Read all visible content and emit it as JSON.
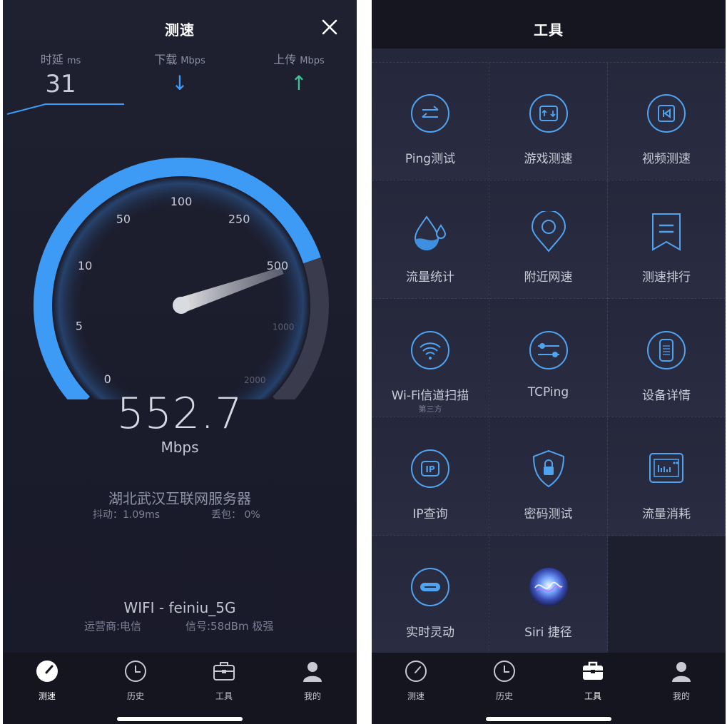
{
  "left": {
    "title": "测速",
    "latency": {
      "label": "时延",
      "unit": "ms",
      "value": "31"
    },
    "download": {
      "label": "下载",
      "unit": "Mbps"
    },
    "upload": {
      "label": "上传",
      "unit": "Mbps"
    },
    "gauge_ticks": [
      "0",
      "5",
      "10",
      "50",
      "100",
      "250",
      "500",
      "1000",
      "2000"
    ],
    "speed": "552.7",
    "speed_unit": "Mbps",
    "server": "湖北武汉互联网服务器",
    "jitter": "抖动：1.09ms",
    "loss": "丢包： 0%",
    "network": "WIFI - feiniu_5G",
    "carrier": "运营商:电信",
    "signal": "信号:58dBm 极强",
    "colors": {
      "accent": "#3d9bf6",
      "download_arrow": "#3d9bf6",
      "upload_arrow": "#3bc29a",
      "gauge_track": "#3a3b4c"
    }
  },
  "right": {
    "title": "工具",
    "tools": [
      {
        "label": "Ping测试",
        "icon": "ping-arrows-icon"
      },
      {
        "label": "游戏测速",
        "icon": "game-speed-icon"
      },
      {
        "label": "视频测速",
        "icon": "video-rewind-icon"
      },
      {
        "label": "流量统计",
        "icon": "water-drop-icon"
      },
      {
        "label": "附近网速",
        "icon": "location-pin-icon"
      },
      {
        "label": "测速排行",
        "icon": "bookmark-ranking-icon"
      },
      {
        "label": "Wi-Fi信道扫描",
        "sub": "第三方",
        "icon": "wifi-icon"
      },
      {
        "label": "TCPing",
        "icon": "toggle-sliders-icon"
      },
      {
        "label": "设备详情",
        "icon": "phone-device-icon"
      },
      {
        "label": "IP查询",
        "icon": "ip-icon"
      },
      {
        "label": "密码测试",
        "icon": "lock-shield-icon"
      },
      {
        "label": "流量消耗",
        "icon": "data-usage-icon"
      },
      {
        "label": "实时灵动",
        "icon": "dynamic-island-icon"
      },
      {
        "label": "Siri 捷径",
        "icon": "siri-icon"
      }
    ]
  },
  "tabbar": {
    "tabs": [
      {
        "label": "测速",
        "icon": "speedometer-icon"
      },
      {
        "label": "历史",
        "icon": "clock-icon"
      },
      {
        "label": "工具",
        "icon": "toolbox-icon"
      },
      {
        "label": "我的",
        "icon": "user-icon"
      }
    ]
  }
}
